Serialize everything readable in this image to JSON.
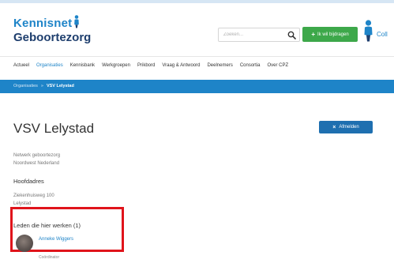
{
  "header": {
    "logo": {
      "line1": "Kennisnet",
      "line2": "Geboortezorg"
    },
    "search": {
      "placeholder": "Zoeken..."
    },
    "add_button_label": "Ik wil bijdragen",
    "user_label": "Coll"
  },
  "nav": {
    "items": [
      {
        "label": "Actueel",
        "active": false
      },
      {
        "label": "Organisaties",
        "active": true
      },
      {
        "label": "Kennisbank",
        "active": false
      },
      {
        "label": "Werkgroepen",
        "active": false
      },
      {
        "label": "Prikbord",
        "active": false
      },
      {
        "label": "Vraag & Antwoord",
        "active": false
      },
      {
        "label": "Deelnemers",
        "active": false
      },
      {
        "label": "Consortia",
        "active": false
      },
      {
        "label": "Over CPZ",
        "active": false
      }
    ]
  },
  "breadcrumb": {
    "parent": "Organisaties",
    "separator": "»",
    "current": "VSV Lelystad"
  },
  "page": {
    "title": "VSV Lelystad",
    "afmelden_label": "Afmelden",
    "network_line1": "Netwerk geboortezorg",
    "network_line2": "Noordwest Nederland",
    "hq_heading": "Hoofdadres",
    "hq_line1": "Ziekenhuisweg 100",
    "hq_line2": "Lelystad",
    "members_heading": "Leden die hier werken (1)",
    "member": {
      "name": "Anneke Wiggers",
      "subtitle": "Coördinator"
    }
  },
  "colors": {
    "brand_blue": "#1e84c8",
    "brand_dark": "#1f3f6e",
    "action_green": "#3da84a",
    "highlight_red": "#e0141b"
  }
}
